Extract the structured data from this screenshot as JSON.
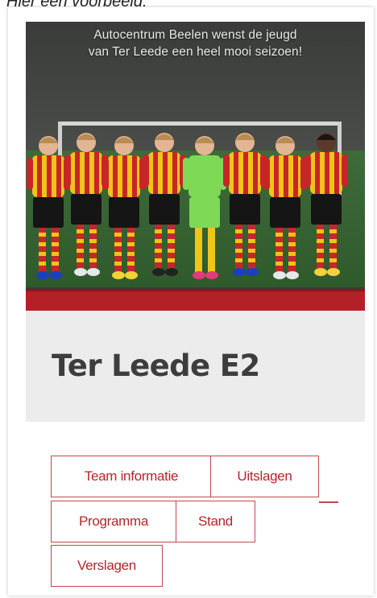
{
  "caption": "Hier een voorbeeld:",
  "photo": {
    "banner_line1": "Autocentrum Beelen wenst de jeugd",
    "banner_line2": "van Ter Leede een heel mooi seizoen!"
  },
  "team": {
    "name": "Ter Leede E2"
  },
  "tabs": [
    {
      "label": "Team informatie"
    },
    {
      "label": "Uitslagen"
    },
    {
      "label": "Programma"
    },
    {
      "label": "Stand"
    },
    {
      "label": "Verslagen"
    }
  ],
  "colors": {
    "accent": "#b3262b",
    "tab_border": "#c0494f",
    "title_bg": "#ececec",
    "jersey_red": "#c8252b",
    "jersey_yellow": "#f0c419",
    "keeper_green": "#7ed957"
  }
}
